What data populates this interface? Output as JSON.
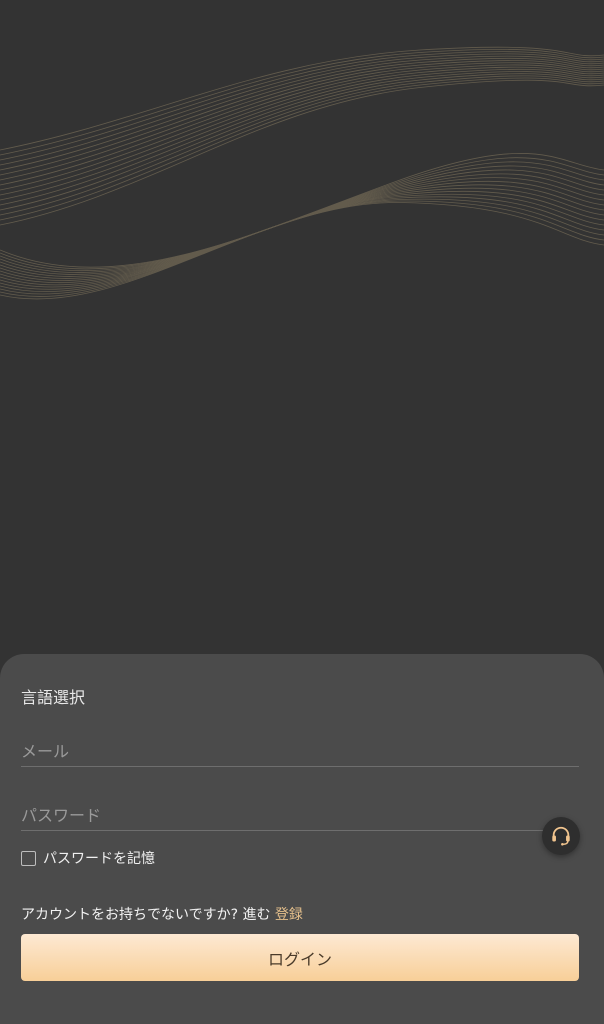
{
  "colors": {
    "background": "#333333",
    "panel": "#4b4b4b",
    "accent": "#e6c08c",
    "button_gradient_top": "#fde9d3",
    "button_gradient_bottom": "#f8cf98"
  },
  "form": {
    "language_select_label": "言語選択",
    "email_placeholder": "メール",
    "password_placeholder": "パスワード",
    "remember_label": "パスワードを記憶",
    "signup_prompt": "アカウントをお持ちでないですか? 進む ",
    "signup_link": "登録",
    "login_label": "ログイン"
  },
  "icons": {
    "support": "headset-icon",
    "checkbox": "checkbox-unchecked"
  }
}
